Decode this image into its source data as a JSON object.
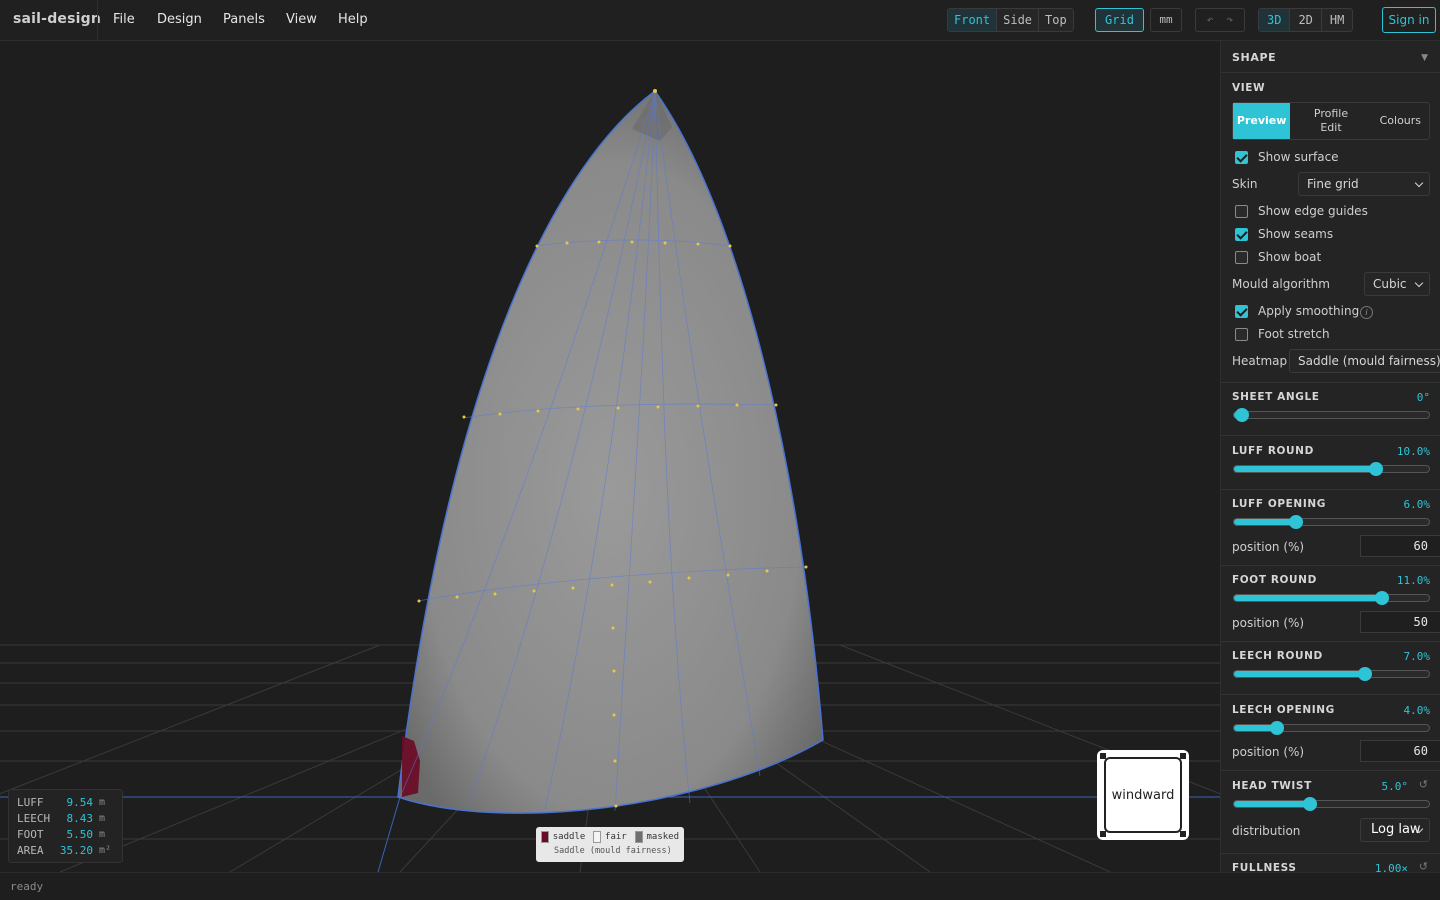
{
  "app": {
    "brand": "sail-design"
  },
  "menu": [
    "File",
    "Design",
    "Panels",
    "View",
    "Help"
  ],
  "views": {
    "items": [
      "Front",
      "Side",
      "Top"
    ],
    "active": "Front"
  },
  "toolbar": {
    "grid": "Grid",
    "unit": "mm",
    "modes": [
      "3D",
      "2D",
      "HM"
    ],
    "active_mode": "3D",
    "signin": "Sign in"
  },
  "status": "ready",
  "stats": [
    {
      "k": "LUFF",
      "v": "9.54",
      "u": "m"
    },
    {
      "k": "LEECH",
      "v": "8.43",
      "u": "m"
    },
    {
      "k": "FOOT",
      "v": "5.50",
      "u": "m"
    },
    {
      "k": "AREA",
      "v": "35.20",
      "u": "m²"
    }
  ],
  "legend": {
    "items": [
      {
        "label": "saddle",
        "color": "#6a0a24"
      },
      {
        "label": "fair",
        "color": "#f4f4f4"
      },
      {
        "label": "masked",
        "color": "#6e6e6e"
      }
    ],
    "caption": "Saddle (mould fairness)"
  },
  "windward": "windward",
  "panel": {
    "title": "SHAPE",
    "view_label": "VIEW",
    "tabs": [
      "Preview",
      "Profile Edit",
      "Colours"
    ],
    "active_tab": "Preview",
    "show_surface": "Show surface",
    "skin_label": "Skin",
    "skin_value": "Fine grid",
    "show_edge_guides": "Show edge guides",
    "show_seams": "Show seams",
    "show_boat": "Show boat",
    "mould_label": "Mould algorithm",
    "mould_value": "Cubic",
    "apply_smoothing": "Apply smoothing",
    "foot_stretch": "Foot stretch",
    "heatmap_label": "Heatmap",
    "heatmap_value": "Saddle (mould fairness)",
    "checks": {
      "show_surface": true,
      "show_edge_guides": false,
      "show_seams": true,
      "show_boat": false,
      "apply_smoothing": true,
      "foot_stretch": false
    },
    "position_label": "position (%)",
    "distribution_label": "distribution",
    "distribution_value": "Log law",
    "sliders": {
      "sheet_angle": {
        "label": "SHEET ANGLE",
        "value": "0°",
        "level": 0.04
      },
      "luff_round": {
        "label": "LUFF ROUND",
        "value": "10.0%",
        "level": 0.73
      },
      "luff_opening": {
        "label": "LUFF OPENING",
        "value": "6.0%",
        "level": 0.32,
        "position": "60"
      },
      "foot_round": {
        "label": "FOOT ROUND",
        "value": "11.0%",
        "level": 0.76,
        "position": "50"
      },
      "leech_round": {
        "label": "LEECH ROUND",
        "value": "7.0%",
        "level": 0.67
      },
      "leech_opening": {
        "label": "LEECH OPENING",
        "value": "4.0%",
        "level": 0.22,
        "position": "60"
      },
      "head_twist": {
        "label": "HEAD TWIST",
        "value": "5.0°",
        "level": 0.39
      },
      "fullness": {
        "label": "FULLNESS",
        "value": "1.00×"
      }
    }
  }
}
